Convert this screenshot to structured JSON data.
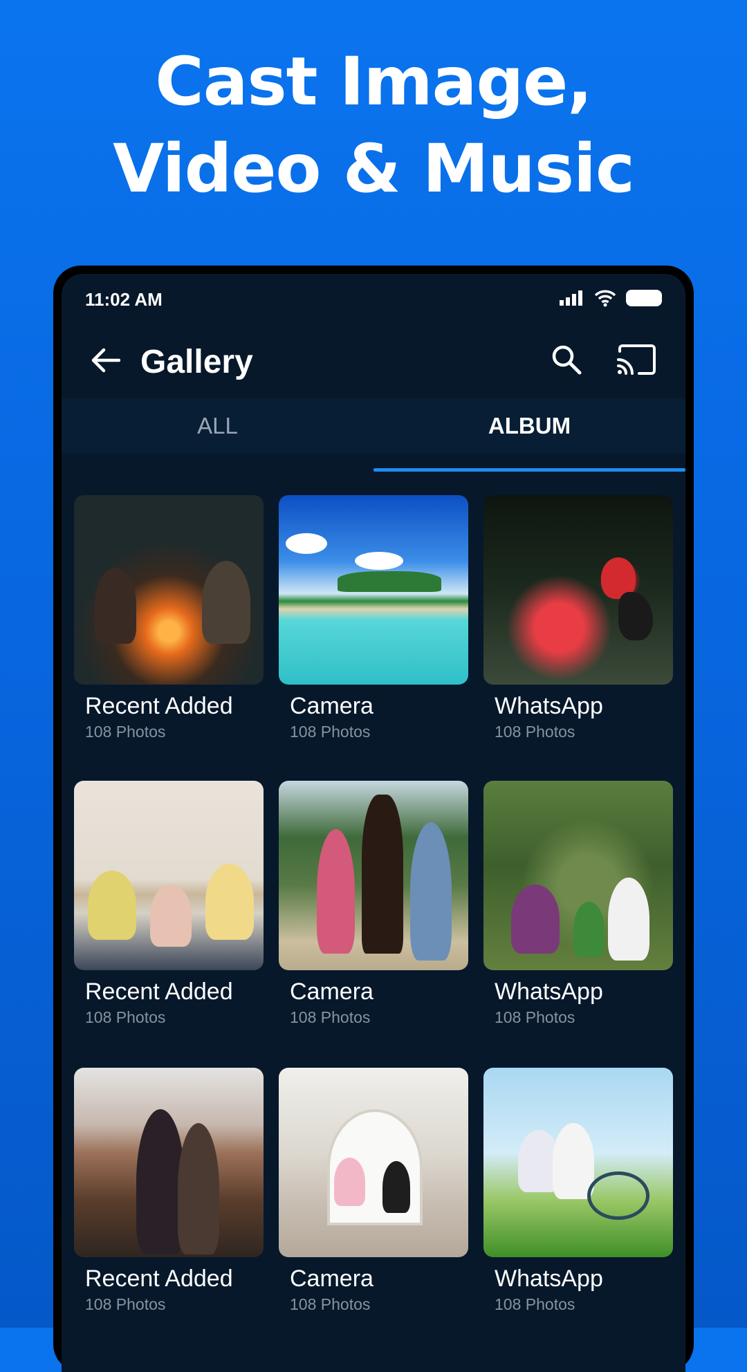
{
  "headline": {
    "line1": "Cast Image,",
    "line2": "Video & Music"
  },
  "status_bar": {
    "time": "11:02 AM",
    "icons": [
      "signal-icon",
      "wifi-icon",
      "battery-icon"
    ]
  },
  "app_bar": {
    "title": "Gallery",
    "icons": [
      "back-arrow-icon",
      "search-icon",
      "cast-icon"
    ]
  },
  "tabs": [
    {
      "label": "ALL",
      "active": false
    },
    {
      "label": "ALBUM",
      "active": true
    }
  ],
  "albums": [
    {
      "name": "Recent Added",
      "count": "108 Photos"
    },
    {
      "name": "Camera",
      "count": "108 Photos"
    },
    {
      "name": "WhatsApp",
      "count": "108 Photos"
    },
    {
      "name": "Recent Added",
      "count": "108 Photos"
    },
    {
      "name": "Camera",
      "count": "108 Photos"
    },
    {
      "name": "WhatsApp",
      "count": "108 Photos"
    },
    {
      "name": "Recent Added",
      "count": "108 Photos"
    },
    {
      "name": "Camera",
      "count": "108 Photos"
    },
    {
      "name": "WhatsApp",
      "count": "108 Photos"
    }
  ],
  "colors": {
    "background": "#0a74ee",
    "screen": "#07182b",
    "accent": "#1f8cf0"
  }
}
